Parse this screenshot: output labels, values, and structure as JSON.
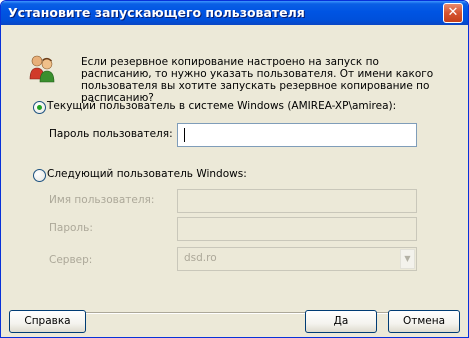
{
  "window": {
    "title": "Установите запускающего пользователя",
    "close_icon": "close-icon"
  },
  "message": "Если резервное копирование настроено на запуск по расписанию, то нужно указать пользователя. От имени какого пользователя вы хотите запускать резервное копирование по расписанию?",
  "icon": "users-icon",
  "current_user": {
    "radio_label": "Текущий пользователь в системе Windows (AMIREA-XP\\amirea):",
    "selected": true,
    "password_label": "Пароль пользователя:",
    "password_value": ""
  },
  "other_user": {
    "radio_label": "Следующий пользователь Windows:",
    "selected": false,
    "username_label": "Имя пользователя:",
    "username_value": "",
    "password_label": "Пароль:",
    "password_value": "",
    "server_label": "Сервер:",
    "server_value": "dsd.ro"
  },
  "buttons": {
    "help": "Справка",
    "ok": "Да",
    "cancel": "Отмена"
  }
}
